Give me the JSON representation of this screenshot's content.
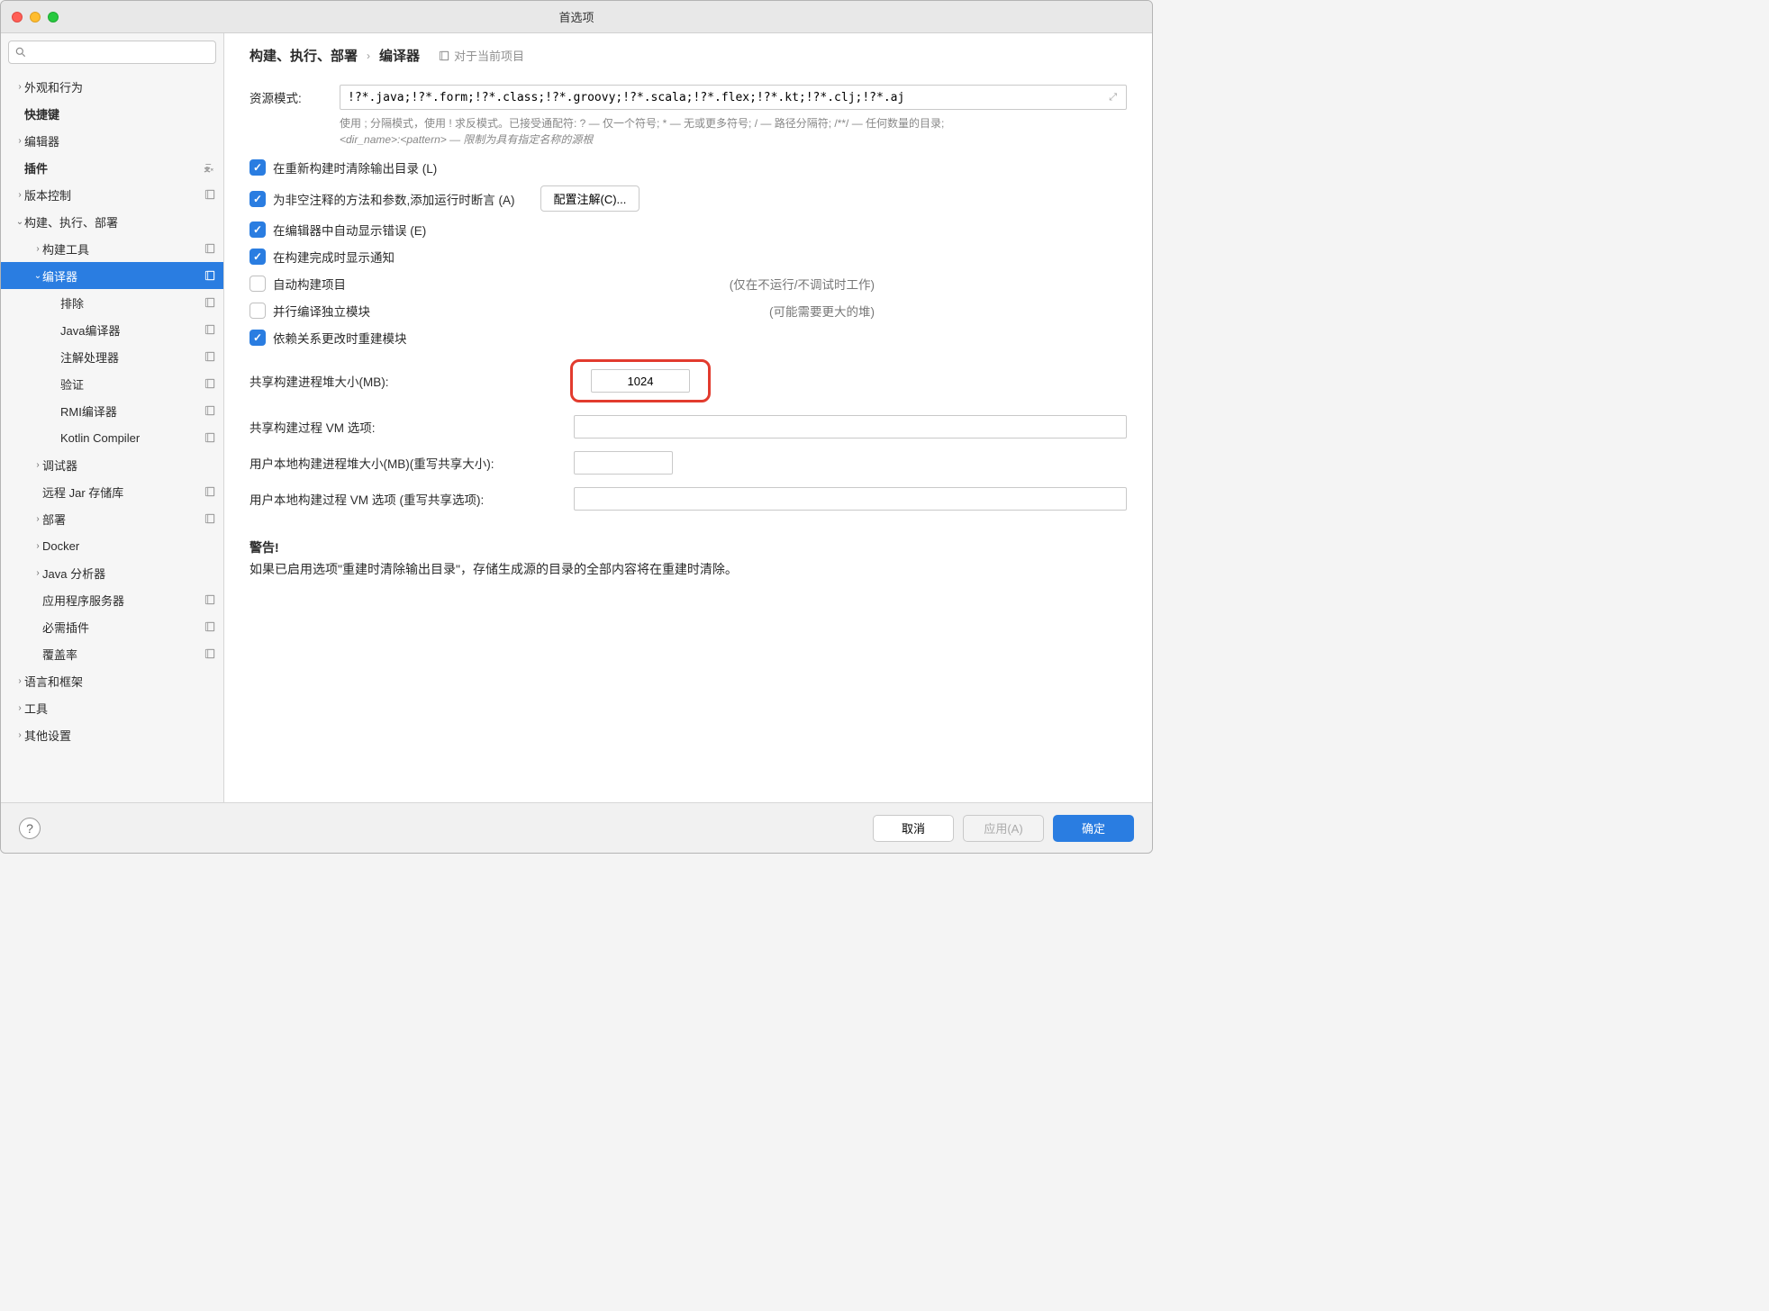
{
  "window": {
    "title": "首选项"
  },
  "search": {
    "placeholder": ""
  },
  "sidebar": {
    "items": [
      {
        "label": "外观和行为",
        "depth": 0,
        "chev": "›",
        "bold": false,
        "trail": null
      },
      {
        "label": "快捷键",
        "depth": 0,
        "chev": "",
        "bold": true,
        "trail": null
      },
      {
        "label": "编辑器",
        "depth": 0,
        "chev": "›",
        "bold": false,
        "trail": null
      },
      {
        "label": "插件",
        "depth": 0,
        "chev": "",
        "bold": true,
        "trail": "lang"
      },
      {
        "label": "版本控制",
        "depth": 0,
        "chev": "›",
        "bold": false,
        "trail": "proj"
      },
      {
        "label": "构建、执行、部署",
        "depth": 0,
        "chev": "⌄",
        "bold": false,
        "trail": null
      },
      {
        "label": "构建工具",
        "depth": 1,
        "chev": "›",
        "bold": false,
        "trail": "proj"
      },
      {
        "label": "编译器",
        "depth": 1,
        "chev": "⌄",
        "bold": false,
        "trail": "proj",
        "selected": true
      },
      {
        "label": "排除",
        "depth": 2,
        "chev": "",
        "bold": false,
        "trail": "proj"
      },
      {
        "label": "Java编译器",
        "depth": 2,
        "chev": "",
        "bold": false,
        "trail": "proj"
      },
      {
        "label": "注解处理器",
        "depth": 2,
        "chev": "",
        "bold": false,
        "trail": "proj"
      },
      {
        "label": "验证",
        "depth": 2,
        "chev": "",
        "bold": false,
        "trail": "proj"
      },
      {
        "label": "RMI编译器",
        "depth": 2,
        "chev": "",
        "bold": false,
        "trail": "proj"
      },
      {
        "label": "Kotlin Compiler",
        "depth": 2,
        "chev": "",
        "bold": false,
        "trail": "proj"
      },
      {
        "label": "调试器",
        "depth": 1,
        "chev": "›",
        "bold": false,
        "trail": null
      },
      {
        "label": "远程 Jar 存储库",
        "depth": 1,
        "chev": "",
        "bold": false,
        "trail": "proj"
      },
      {
        "label": "部署",
        "depth": 1,
        "chev": "›",
        "bold": false,
        "trail": "proj"
      },
      {
        "label": "Docker",
        "depth": 1,
        "chev": "›",
        "bold": false,
        "trail": null
      },
      {
        "label": "Java 分析器",
        "depth": 1,
        "chev": "›",
        "bold": false,
        "trail": null
      },
      {
        "label": "应用程序服务器",
        "depth": 1,
        "chev": "",
        "bold": false,
        "trail": "proj"
      },
      {
        "label": "必需插件",
        "depth": 1,
        "chev": "",
        "bold": false,
        "trail": "proj"
      },
      {
        "label": "覆盖率",
        "depth": 1,
        "chev": "",
        "bold": false,
        "trail": "proj"
      },
      {
        "label": "语言和框架",
        "depth": 0,
        "chev": "›",
        "bold": false,
        "trail": null
      },
      {
        "label": "工具",
        "depth": 0,
        "chev": "›",
        "bold": false,
        "trail": null
      },
      {
        "label": "其他设置",
        "depth": 0,
        "chev": "›",
        "bold": false,
        "trail": null
      }
    ]
  },
  "breadcrumb": {
    "parent": "构建、执行、部署",
    "current": "编译器",
    "badge": "对于当前项目"
  },
  "main": {
    "resourcePatternLabel": "资源模式:",
    "resourcePatternValue": "!?*.java;!?*.form;!?*.class;!?*.groovy;!?*.scala;!?*.flex;!?*.kt;!?*.clj;!?*.aj",
    "hintLine1": "使用 ; 分隔模式，使用 ! 求反模式。已接受通配符: ? — 仅一个符号;  * — 无或更多符号;  / — 路径分隔符;  /**/ — 任何数量的目录;",
    "hintLine2": "<dir_name>:<pattern> — 限制为具有指定名称的源根",
    "cb_clearOutput": "在重新构建时清除输出目录 (L)",
    "cb_runtimeAssert": "为非空注释的方法和参数,添加运行时断言 (A)",
    "btn_configAnnotations": "配置注解(C)...",
    "cb_showErrors": "在编辑器中自动显示错误 (E)",
    "cb_showNotif": "在构建完成时显示通知",
    "cb_autoBuild": "自动构建项目",
    "note_autoBuild": "(仅在不运行/不调试时工作)",
    "cb_parallel": "并行编译独立模块",
    "note_parallel": "(可能需要更大的堆)",
    "cb_rebuildDeps": "依赖关系更改时重建模块",
    "lbl_sharedHeap": "共享构建进程堆大小(MB):",
    "val_sharedHeap": "1024",
    "lbl_sharedVmOpts": "共享构建过程 VM 选项:",
    "val_sharedVmOpts": "",
    "lbl_userHeap": "用户本地构建进程堆大小(MB)(重写共享大小):",
    "val_userHeap": "",
    "lbl_userVmOpts": "用户本地构建过程 VM 选项 (重写共享选项):",
    "val_userVmOpts": "",
    "warningTitle": "警告!",
    "warningBody": "如果已启用选项\"重建时清除输出目录\"，存储生成源的目录的全部内容将在重建时清除。"
  },
  "footer": {
    "cancel": "取消",
    "apply": "应用(A)",
    "ok": "确定"
  }
}
